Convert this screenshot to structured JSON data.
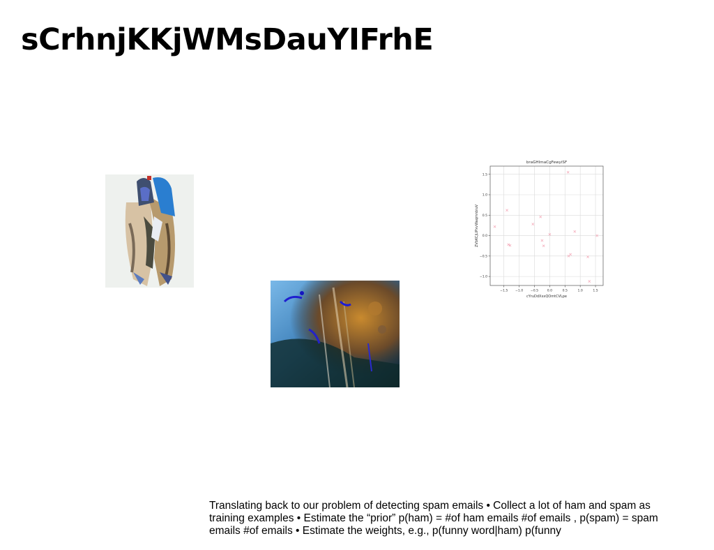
{
  "slide": {
    "title": "sCrhnjKKjWMsDauYIFrhE",
    "body": "Translating back to our problem of detecting spam emails • Collect a lot of ham and spam as training examples • Estimate the “prior” p(ham) = #of ham emails #of emails , p(spam) = spam emails #of emails • Estimate the weights, e.g., p(funny word|ham) p(funny"
  },
  "chart_data": {
    "type": "scatter",
    "title": "braGHImaCgFewyiSF",
    "xlabel": "cYruDdXxxQOmtCVLpe",
    "ylabel": "ZVbKCjLIPxvWaqmnbiuV",
    "xlim": [
      -1.95,
      1.75
    ],
    "ylim": [
      -1.22,
      1.7
    ],
    "xticks": [
      "-1.5",
      "-1.0",
      "-0.5",
      "0.0",
      "0.5",
      "1.0",
      "1.5"
    ],
    "yticks": [
      "-1.0",
      "-0.5",
      "0.0",
      "0.5",
      "1.0",
      "1.5"
    ],
    "grid": true,
    "marker": "x",
    "color": "#f4a6b6",
    "points": [
      {
        "x": -1.8,
        "y": 0.22
      },
      {
        "x": -1.4,
        "y": 0.62
      },
      {
        "x": -1.35,
        "y": -0.22
      },
      {
        "x": -1.3,
        "y": -0.24
      },
      {
        "x": -0.55,
        "y": 0.28
      },
      {
        "x": -0.3,
        "y": 0.46
      },
      {
        "x": -0.25,
        "y": -0.12
      },
      {
        "x": -0.2,
        "y": -0.25
      },
      {
        "x": 0.0,
        "y": 0.03
      },
      {
        "x": 0.6,
        "y": 1.55
      },
      {
        "x": 0.62,
        "y": -0.5
      },
      {
        "x": 0.68,
        "y": -0.46
      },
      {
        "x": 0.82,
        "y": 0.1
      },
      {
        "x": 1.25,
        "y": -0.52
      },
      {
        "x": 1.3,
        "y": -1.12
      },
      {
        "x": 1.55,
        "y": 0.0
      }
    ]
  }
}
